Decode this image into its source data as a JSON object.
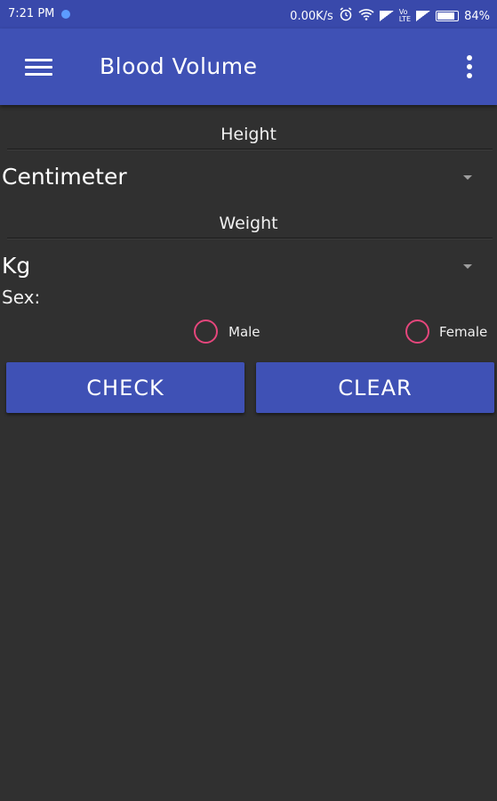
{
  "status_bar": {
    "time": "7:21 PM",
    "network_speed": "0.00K/s",
    "battery": "84%",
    "icons": [
      "notification-dot-icon",
      "alarm-icon",
      "wifi-icon",
      "signal-icon",
      "volte-icon",
      "signal-icon",
      "battery-icon"
    ]
  },
  "app_bar": {
    "title": "Blood Volume",
    "menu_icon": "hamburger-menu-icon",
    "overflow_icon": "more-vertical-icon",
    "color": "#3f51b5"
  },
  "form": {
    "height": {
      "label": "Height",
      "unit_selected": "Centimeter"
    },
    "weight": {
      "label": "Weight",
      "unit_selected": "Kg"
    },
    "sex": {
      "label": "Sex:",
      "options": [
        "Male",
        "Female"
      ],
      "radio_color": "#e5467c"
    }
  },
  "buttons": {
    "check": "CHECK",
    "clear": "CLEAR",
    "color": "#3f51b5"
  },
  "colors": {
    "background": "#303030",
    "accent": "#e5467c"
  }
}
